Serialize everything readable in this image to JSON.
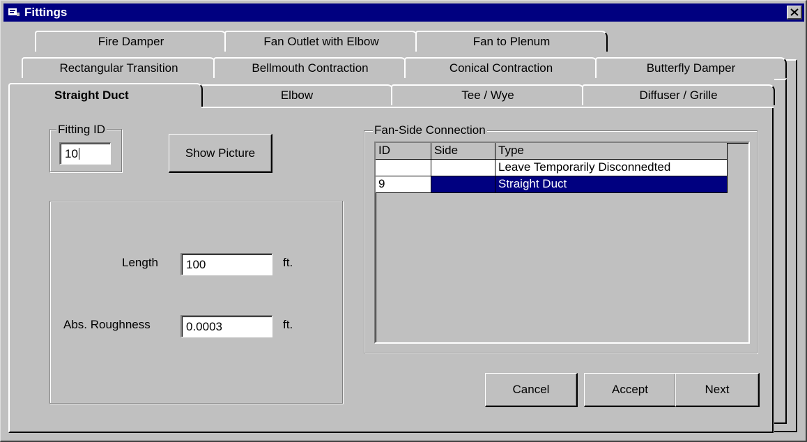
{
  "window": {
    "title": "Fittings"
  },
  "tabs": {
    "row1": [
      "Fire Damper",
      "Fan Outlet with Elbow",
      "Fan to Plenum"
    ],
    "row2": [
      "Rectangular Transition",
      "Bellmouth Contraction",
      "Conical Contraction",
      "Butterfly Damper"
    ],
    "row3": [
      "Straight Duct",
      "Elbow",
      "Tee / Wye",
      "Diffuser / Grille"
    ],
    "selected": "Straight Duct"
  },
  "fitting_id": {
    "label": "Fitting ID",
    "value": "10"
  },
  "show_picture_label": "Show Picture",
  "params": {
    "length_label": "Length",
    "length_value": "100",
    "length_unit": "ft.",
    "roughness_label": "Abs. Roughness",
    "roughness_value": "0.0003",
    "roughness_unit": "ft."
  },
  "fan_side": {
    "label": "Fan-Side Connection",
    "columns": [
      "ID",
      "Side",
      "Type"
    ],
    "rows": [
      {
        "id": "",
        "side": "",
        "type": "Leave Temporarily Disconnedted"
      },
      {
        "id": "9",
        "side": "",
        "type": "Straight Duct",
        "selected": true
      }
    ]
  },
  "buttons": {
    "cancel": "Cancel",
    "accept": "Accept",
    "next": "Next"
  },
  "colors": {
    "titlebar": "#000080",
    "face": "#c0c0c0",
    "selection": "#000080"
  }
}
